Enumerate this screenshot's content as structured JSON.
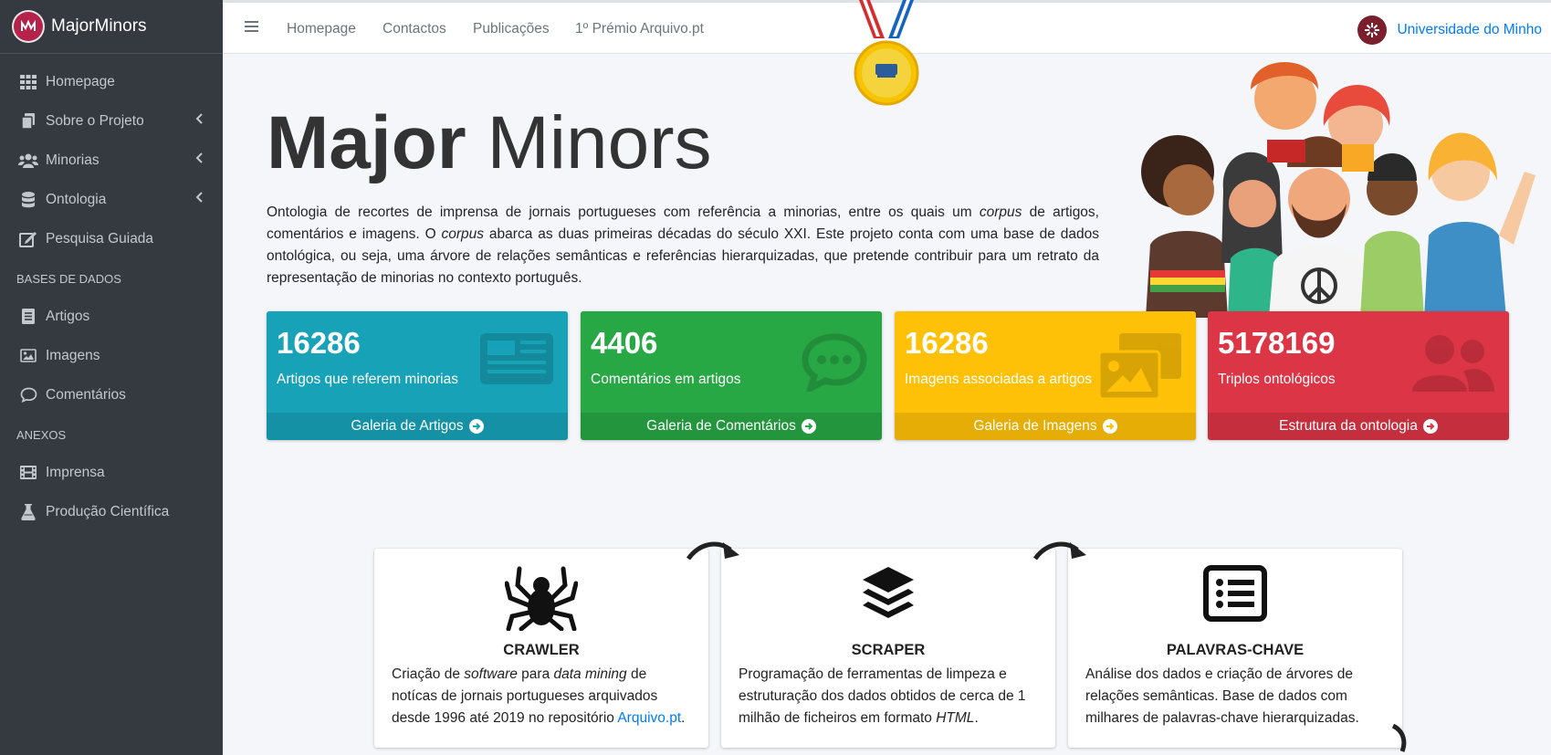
{
  "sidebar": {
    "brand": "MajorMinors",
    "items": [
      {
        "label": "Homepage",
        "icon": "grid-icon"
      },
      {
        "label": "Sobre o Projeto",
        "icon": "copy-icon"
      },
      {
        "label": "Minorias",
        "icon": "users-icon"
      },
      {
        "label": "Ontologia",
        "icon": "database-icon"
      },
      {
        "label": "Pesquisa Guiada",
        "icon": "edit-icon"
      }
    ],
    "section_databases": "BASES DE DADOS",
    "db_items": [
      {
        "label": "Artigos",
        "icon": "newspaper-icon"
      },
      {
        "label": "Imagens",
        "icon": "image-icon"
      },
      {
        "label": "Comentários",
        "icon": "comment-icon"
      }
    ],
    "section_annexes": "ANEXOS",
    "annex_items": [
      {
        "label": "Imprensa",
        "icon": "film-icon"
      },
      {
        "label": "Produção Científica",
        "icon": "flask-icon"
      }
    ]
  },
  "topbar": {
    "links": [
      "Homepage",
      "Contactos",
      "Publicações",
      "1º Prémio Arquivo.pt"
    ],
    "university": "Universidade do Minho"
  },
  "hero": {
    "title_bold": "Major",
    "title_light": "Minors",
    "desc_1": "Ontologia de recortes de imprensa de jornais portugueses com referência a minorias, entre os quais um ",
    "desc_corpus1": "corpus",
    "desc_2": " de artigos, comentários e imagens. O ",
    "desc_corpus2": "corpus",
    "desc_3": " abarca as duas primeiras décadas do século XXI. Este projeto conta com uma base de dados ontológica, ou seja, uma árvore de relações semânticas e referências hierarquizadas, que pretende contribuir para um retrato da representação de minorias no contexto português."
  },
  "stats": [
    {
      "value": "16286",
      "label": "Artigos que referem minorias",
      "link": "Galeria de Artigos",
      "color": "#17a2b8"
    },
    {
      "value": "4406",
      "label": "Comentários em artigos",
      "link": "Galeria de Comentários",
      "color": "#28a745"
    },
    {
      "value": "16286",
      "label": "Imagens associadas a artigos",
      "link": "Galeria de Imagens",
      "color": "#ffc107"
    },
    {
      "value": "5178169",
      "label": "Triplos ontológicos",
      "link": "Estrutura da ontologia",
      "color": "#dc3545"
    }
  ],
  "cards": [
    {
      "title": "CRAWLER",
      "icon": "spider-icon",
      "t1": "Criação de ",
      "i1": "software",
      "t2": " para ",
      "i2": "data mining",
      "t3": " de notícas de jornais portugueses arquivados desde 1996 até 2019 no repositório ",
      "link": "Arquivo.pt",
      "t4": "."
    },
    {
      "title": "SCRAPER",
      "icon": "layers-icon",
      "t1": "Programação de ferramentas de limpeza e estruturação dos dados obtidos de cerca de 1 milhão de ficheiros em formato ",
      "i1": "HTML",
      "t2": "."
    },
    {
      "title": "PALAVRAS-CHAVE",
      "icon": "list-alt-icon",
      "t1": "Análise dos dados e criação de árvores de relações semânticas. Base de dados com milhares de palavras-chave hierarquizadas."
    }
  ]
}
